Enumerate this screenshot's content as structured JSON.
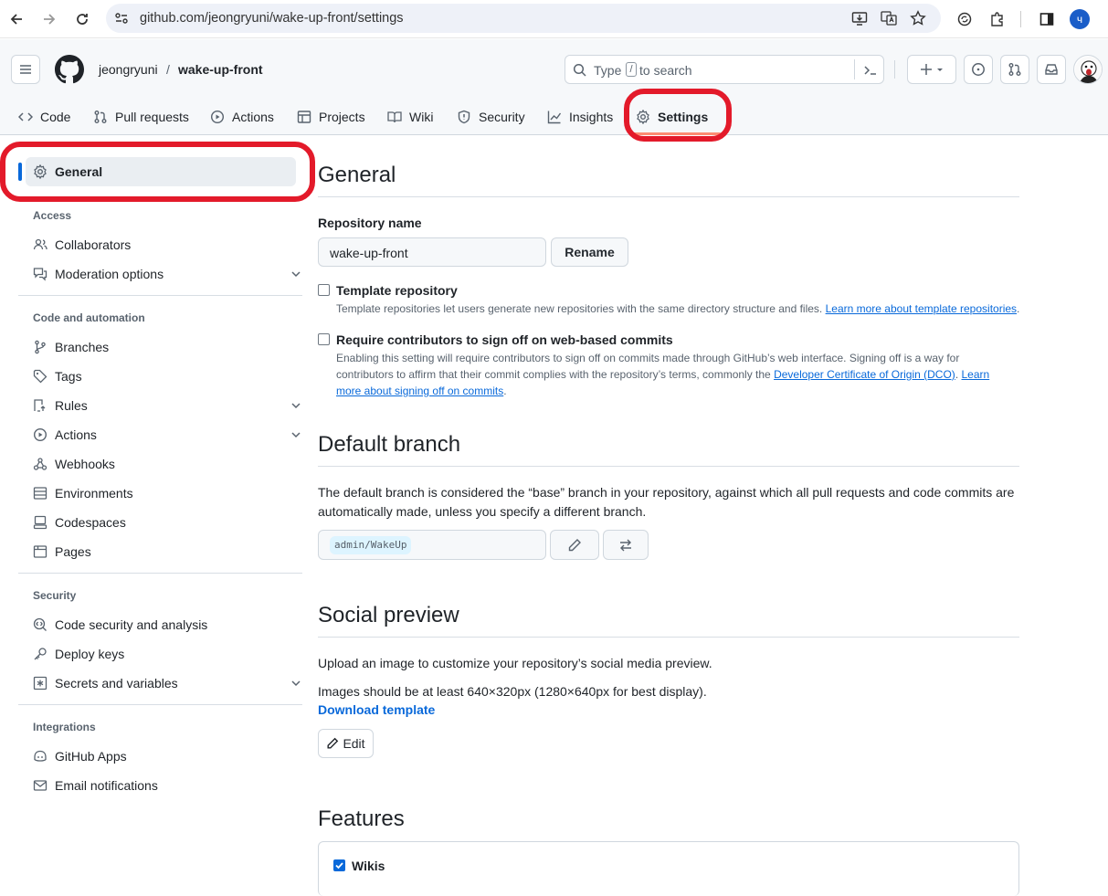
{
  "browser": {
    "url": "github.com/jeongryuni/wake-up-front/settings",
    "profile_initial": "ч"
  },
  "header": {
    "owner": "jeongryuni",
    "separator": "/",
    "repo": "wake-up-front",
    "search_prefix": "Type",
    "search_key": "/",
    "search_suffix": "to search"
  },
  "tabs": [
    {
      "label": "Code",
      "icon": "code-icon"
    },
    {
      "label": "Pull requests",
      "icon": "git-pull-request-icon"
    },
    {
      "label": "Actions",
      "icon": "play-icon"
    },
    {
      "label": "Projects",
      "icon": "table-icon"
    },
    {
      "label": "Wiki",
      "icon": "book-icon"
    },
    {
      "label": "Security",
      "icon": "shield-icon"
    },
    {
      "label": "Insights",
      "icon": "graph-icon"
    },
    {
      "label": "Settings",
      "icon": "gear-icon",
      "selected": true
    }
  ],
  "sidebar": {
    "general": "General",
    "access_heading": "Access",
    "access": [
      "Collaborators",
      "Moderation options"
    ],
    "code_heading": "Code and automation",
    "code": [
      "Branches",
      "Tags",
      "Rules",
      "Actions",
      "Webhooks",
      "Environments",
      "Codespaces",
      "Pages"
    ],
    "security_heading": "Security",
    "security": [
      "Code security and analysis",
      "Deploy keys",
      "Secrets and variables"
    ],
    "integrations_heading": "Integrations",
    "integrations": [
      "GitHub Apps",
      "Email notifications"
    ]
  },
  "general": {
    "title": "General",
    "repo_name_label": "Repository name",
    "repo_name_value": "wake-up-front",
    "rename_button": "Rename",
    "template_label": "Template repository",
    "template_note": "Template repositories let users generate new repositories with the same directory structure and files.",
    "template_link": "Learn more about template repositories",
    "template_after": ".",
    "template_checked": false,
    "signoff_label": "Require contributors to sign off on web-based commits",
    "signoff_note_1": "Enabling this setting will require contributors to sign off on commits made through GitHub’s web interface. Signing off is a way for",
    "signoff_note_2": "contributors to affirm that their commit complies with the repository’s terms, commonly the",
    "signoff_link_1": "Developer Certificate of Origin (DCO)",
    "signoff_mid": ".",
    "signoff_link_2a": "Learn",
    "signoff_link_2b": "more about signing off on commits",
    "signoff_after": ".",
    "signoff_checked": false
  },
  "default_branch": {
    "title": "Default branch",
    "text_1": "The default branch is considered the “base” branch in your repository, against which all pull requests and code commits are",
    "text_2": "automatically made, unless you specify a different branch.",
    "branch": "admin/WakeUp"
  },
  "social": {
    "title": "Social preview",
    "text_1": "Upload an image to customize your repository’s social media preview.",
    "text_2": "Images should be at least 640×320px (1280×640px for best display).",
    "download": "Download template",
    "edit": "Edit"
  },
  "features": {
    "title": "Features",
    "wikis_label": "Wikis",
    "wikis_checked": true
  }
}
